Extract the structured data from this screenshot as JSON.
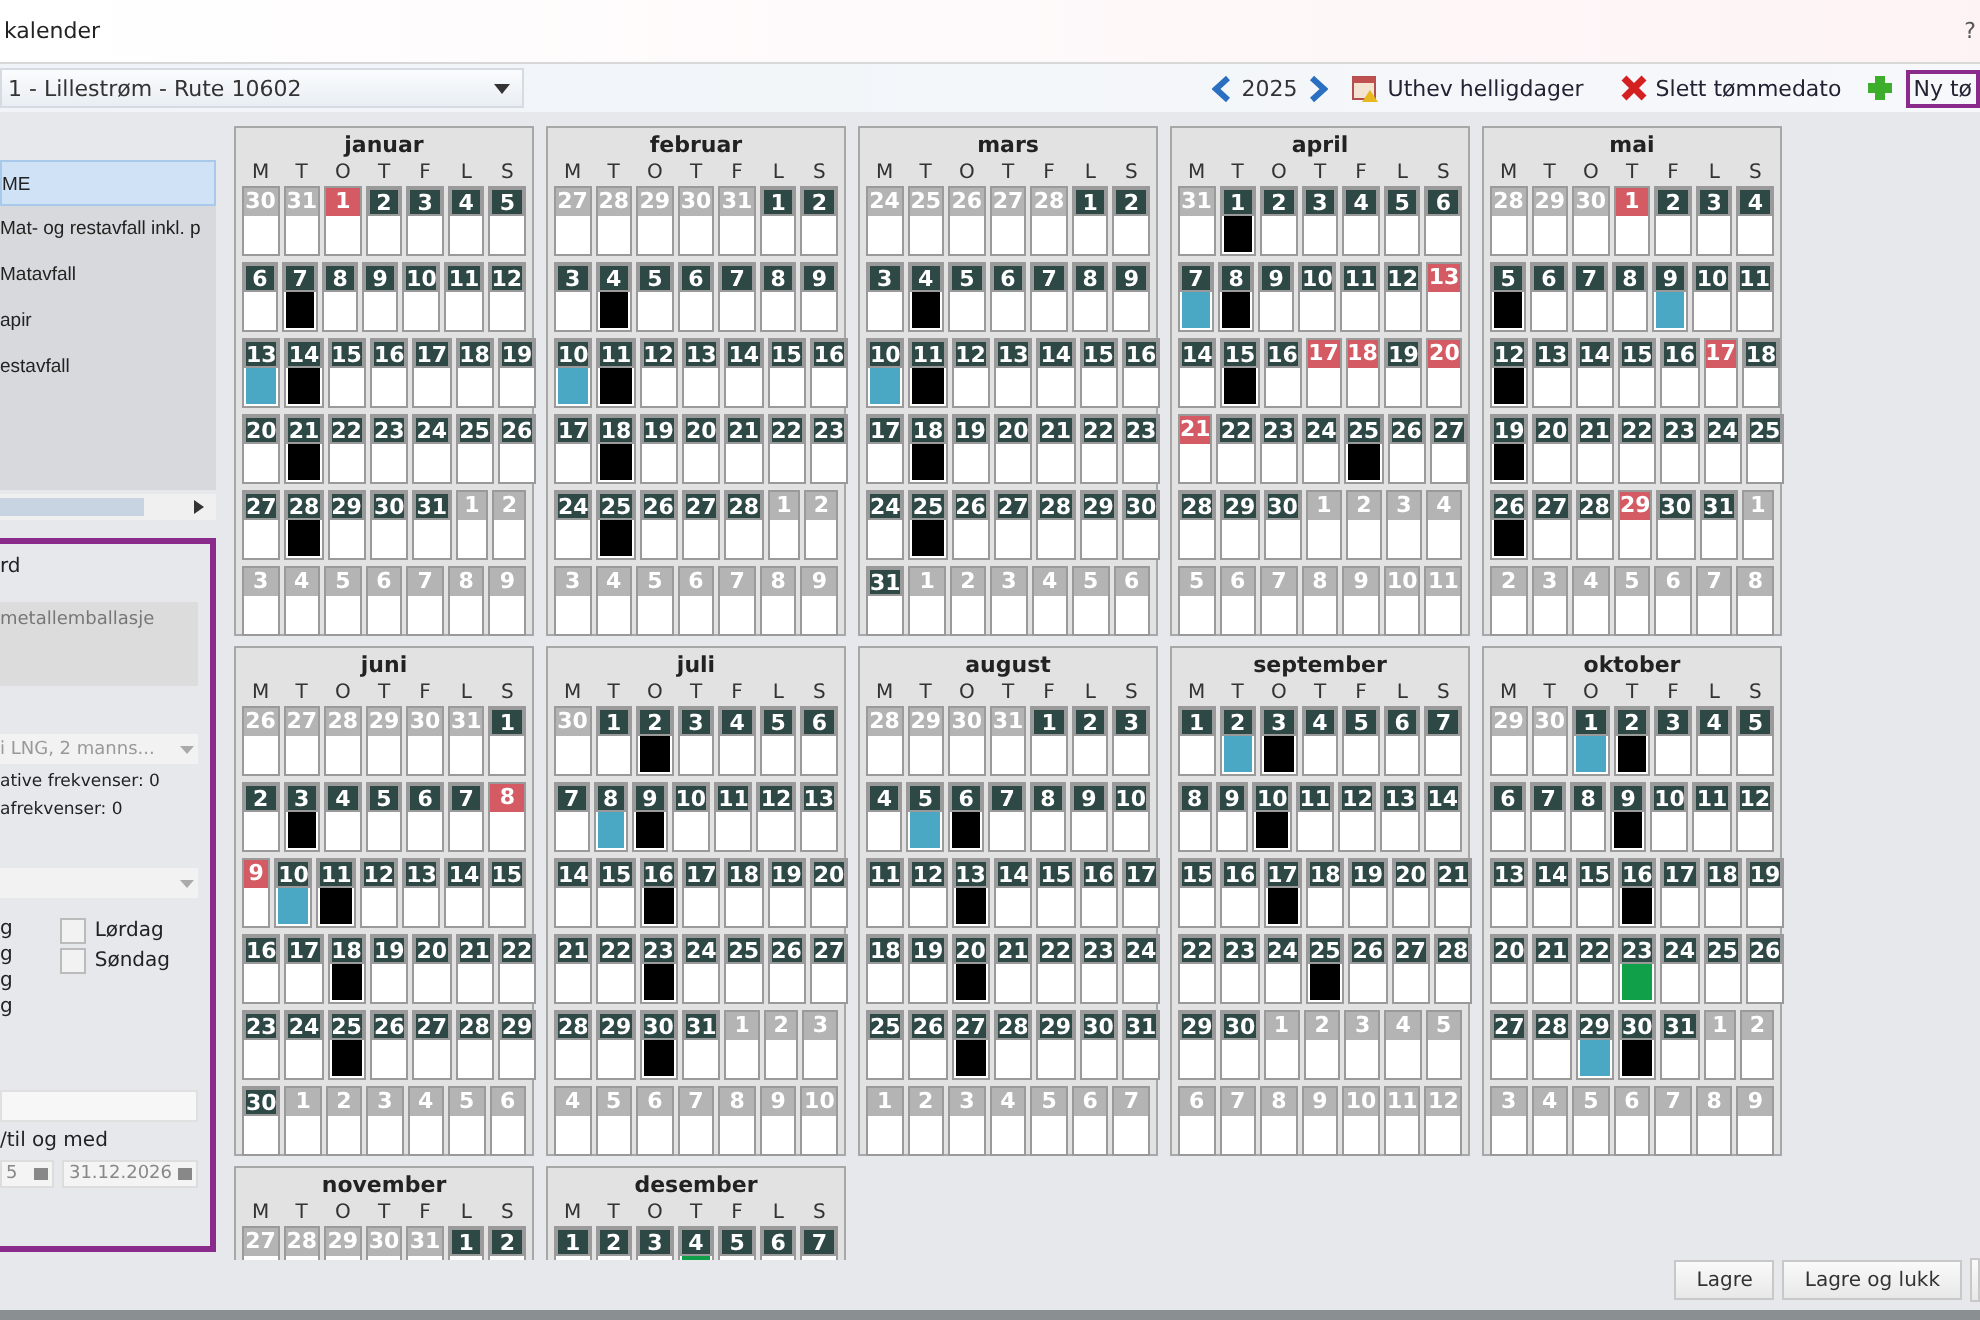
{
  "window": {
    "title": "kalender",
    "help": "?"
  },
  "route_select": {
    "value": "1 - Lillestrøm - Rute 10602"
  },
  "toolbar": {
    "year": "2025",
    "highlight_holidays": "Uthev helligdager",
    "delete_date": "Slett tømmedato",
    "new_date": "Ny tø"
  },
  "waste_list": {
    "items": [
      {
        "label": "ME",
        "selected": true
      },
      {
        "label": "Mat- og restavfall inkl. p",
        "selected": false
      },
      {
        "label": "Matavfall",
        "selected": false
      },
      {
        "label": "apir",
        "selected": false
      },
      {
        "label": "estavfall",
        "selected": false
      }
    ]
  },
  "details": {
    "label": "rd",
    "description": "metallemballasje",
    "vehicle_select": "i LNG, 2 manns...",
    "alt_freq": "ative frekvenser: 0",
    "extra_freq": "afrekvenser: 0",
    "weekdays": [
      "g",
      "g",
      "g",
      "g"
    ],
    "weekend": [
      {
        "label": "Lørdag",
        "checked": false
      },
      {
        "label": "Søndag",
        "checked": false
      }
    ],
    "period_label": "/til og med",
    "from_date": "5",
    "to_date": "31.12.2026"
  },
  "months": [
    {
      "name": "januar",
      "weekdays": [
        "M",
        "T",
        "O",
        "T",
        "F",
        "L",
        "S"
      ],
      "weeks": [
        [
          {
            "n": "30",
            "kind": "other"
          },
          {
            "n": "31",
            "kind": "other"
          },
          {
            "n": "1",
            "kind": "holiday"
          },
          {
            "n": "2",
            "kind": "day"
          },
          {
            "n": "3",
            "kind": "day"
          },
          {
            "n": "4",
            "kind": "day"
          },
          {
            "n": "5",
            "kind": "day"
          }
        ],
        [
          {
            "n": "6",
            "kind": "day"
          },
          {
            "n": "7",
            "kind": "day",
            "color": "#000000"
          },
          {
            "n": "8",
            "kind": "day"
          },
          {
            "n": "9",
            "kind": "day"
          },
          {
            "n": "10",
            "kind": "day"
          },
          {
            "n": "11",
            "kind": "day"
          },
          {
            "n": "12",
            "kind": "day"
          }
        ],
        [
          {
            "n": "13",
            "kind": "day",
            "color": "#4aa8c4"
          },
          {
            "n": "14",
            "kind": "day",
            "color": "#000000"
          },
          {
            "n": "15",
            "kind": "day"
          },
          {
            "n": "16",
            "kind": "day"
          },
          {
            "n": "17",
            "kind": "day"
          },
          {
            "n": "18",
            "kind": "day"
          },
          {
            "n": "19",
            "kind": "day"
          }
        ],
        [
          {
            "n": "20",
            "kind": "day"
          },
          {
            "n": "21",
            "kind": "day",
            "color": "#000000"
          },
          {
            "n": "22",
            "kind": "day"
          },
          {
            "n": "23",
            "kind": "day"
          },
          {
            "n": "24",
            "kind": "day"
          },
          {
            "n": "25",
            "kind": "day"
          },
          {
            "n": "26",
            "kind": "day"
          }
        ],
        [
          {
            "n": "27",
            "kind": "day"
          },
          {
            "n": "28",
            "kind": "day",
            "color": "#000000"
          },
          {
            "n": "29",
            "kind": "day"
          },
          {
            "n": "30",
            "kind": "day"
          },
          {
            "n": "31",
            "kind": "day"
          },
          {
            "n": "1",
            "kind": "other"
          },
          {
            "n": "2",
            "kind": "other"
          }
        ],
        [
          {
            "n": "3",
            "kind": "other"
          },
          {
            "n": "4",
            "kind": "other"
          },
          {
            "n": "5",
            "kind": "other"
          },
          {
            "n": "6",
            "kind": "other"
          },
          {
            "n": "7",
            "kind": "other"
          },
          {
            "n": "8",
            "kind": "other"
          },
          {
            "n": "9",
            "kind": "other"
          }
        ]
      ]
    },
    {
      "name": "februar",
      "weekdays": [
        "M",
        "T",
        "O",
        "T",
        "F",
        "L",
        "S"
      ],
      "weeks": [
        [
          {
            "n": "27",
            "kind": "other"
          },
          {
            "n": "28",
            "kind": "other"
          },
          {
            "n": "29",
            "kind": "other"
          },
          {
            "n": "30",
            "kind": "other"
          },
          {
            "n": "31",
            "kind": "other"
          },
          {
            "n": "1",
            "kind": "day"
          },
          {
            "n": "2",
            "kind": "day"
          }
        ],
        [
          {
            "n": "3",
            "kind": "day"
          },
          {
            "n": "4",
            "kind": "day",
            "color": "#000000"
          },
          {
            "n": "5",
            "kind": "day"
          },
          {
            "n": "6",
            "kind": "day"
          },
          {
            "n": "7",
            "kind": "day"
          },
          {
            "n": "8",
            "kind": "day"
          },
          {
            "n": "9",
            "kind": "day"
          }
        ],
        [
          {
            "n": "10",
            "kind": "day",
            "color": "#4aa8c4"
          },
          {
            "n": "11",
            "kind": "day",
            "color": "#000000"
          },
          {
            "n": "12",
            "kind": "day"
          },
          {
            "n": "13",
            "kind": "day"
          },
          {
            "n": "14",
            "kind": "day"
          },
          {
            "n": "15",
            "kind": "day"
          },
          {
            "n": "16",
            "kind": "day"
          }
        ],
        [
          {
            "n": "17",
            "kind": "day"
          },
          {
            "n": "18",
            "kind": "day",
            "color": "#000000"
          },
          {
            "n": "19",
            "kind": "day"
          },
          {
            "n": "20",
            "kind": "day"
          },
          {
            "n": "21",
            "kind": "day"
          },
          {
            "n": "22",
            "kind": "day"
          },
          {
            "n": "23",
            "kind": "day"
          }
        ],
        [
          {
            "n": "24",
            "kind": "day"
          },
          {
            "n": "25",
            "kind": "day",
            "color": "#000000"
          },
          {
            "n": "26",
            "kind": "day"
          },
          {
            "n": "27",
            "kind": "day"
          },
          {
            "n": "28",
            "kind": "day"
          },
          {
            "n": "1",
            "kind": "other"
          },
          {
            "n": "2",
            "kind": "other"
          }
        ],
        [
          {
            "n": "3",
            "kind": "other"
          },
          {
            "n": "4",
            "kind": "other"
          },
          {
            "n": "5",
            "kind": "other"
          },
          {
            "n": "6",
            "kind": "other"
          },
          {
            "n": "7",
            "kind": "other"
          },
          {
            "n": "8",
            "kind": "other"
          },
          {
            "n": "9",
            "kind": "other"
          }
        ]
      ]
    },
    {
      "name": "mars",
      "weekdays": [
        "M",
        "T",
        "O",
        "T",
        "F",
        "L",
        "S"
      ],
      "weeks": [
        [
          {
            "n": "24",
            "kind": "other"
          },
          {
            "n": "25",
            "kind": "other"
          },
          {
            "n": "26",
            "kind": "other"
          },
          {
            "n": "27",
            "kind": "other"
          },
          {
            "n": "28",
            "kind": "other"
          },
          {
            "n": "1",
            "kind": "day"
          },
          {
            "n": "2",
            "kind": "day"
          }
        ],
        [
          {
            "n": "3",
            "kind": "day"
          },
          {
            "n": "4",
            "kind": "day",
            "color": "#000000"
          },
          {
            "n": "5",
            "kind": "day"
          },
          {
            "n": "6",
            "kind": "day"
          },
          {
            "n": "7",
            "kind": "day"
          },
          {
            "n": "8",
            "kind": "day"
          },
          {
            "n": "9",
            "kind": "day"
          }
        ],
        [
          {
            "n": "10",
            "kind": "day",
            "color": "#4aa8c4"
          },
          {
            "n": "11",
            "kind": "day",
            "color": "#000000"
          },
          {
            "n": "12",
            "kind": "day"
          },
          {
            "n": "13",
            "kind": "day"
          },
          {
            "n": "14",
            "kind": "day"
          },
          {
            "n": "15",
            "kind": "day"
          },
          {
            "n": "16",
            "kind": "day"
          }
        ],
        [
          {
            "n": "17",
            "kind": "day"
          },
          {
            "n": "18",
            "kind": "day",
            "color": "#000000"
          },
          {
            "n": "19",
            "kind": "day"
          },
          {
            "n": "20",
            "kind": "day"
          },
          {
            "n": "21",
            "kind": "day"
          },
          {
            "n": "22",
            "kind": "day"
          },
          {
            "n": "23",
            "kind": "day"
          }
        ],
        [
          {
            "n": "24",
            "kind": "day"
          },
          {
            "n": "25",
            "kind": "day",
            "color": "#000000"
          },
          {
            "n": "26",
            "kind": "day"
          },
          {
            "n": "27",
            "kind": "day"
          },
          {
            "n": "28",
            "kind": "day"
          },
          {
            "n": "29",
            "kind": "day"
          },
          {
            "n": "30",
            "kind": "day"
          }
        ],
        [
          {
            "n": "31",
            "kind": "day"
          },
          {
            "n": "1",
            "kind": "other"
          },
          {
            "n": "2",
            "kind": "other"
          },
          {
            "n": "3",
            "kind": "other"
          },
          {
            "n": "4",
            "kind": "other"
          },
          {
            "n": "5",
            "kind": "other"
          },
          {
            "n": "6",
            "kind": "other"
          }
        ]
      ]
    },
    {
      "name": "april",
      "weekdays": [
        "M",
        "T",
        "O",
        "T",
        "F",
        "L",
        "S"
      ],
      "weeks": [
        [
          {
            "n": "31",
            "kind": "other"
          },
          {
            "n": "1",
            "kind": "day",
            "color": "#000000"
          },
          {
            "n": "2",
            "kind": "day"
          },
          {
            "n": "3",
            "kind": "day"
          },
          {
            "n": "4",
            "kind": "day"
          },
          {
            "n": "5",
            "kind": "day"
          },
          {
            "n": "6",
            "kind": "day"
          }
        ],
        [
          {
            "n": "7",
            "kind": "day",
            "color": "#4aa8c4"
          },
          {
            "n": "8",
            "kind": "day",
            "color": "#000000"
          },
          {
            "n": "9",
            "kind": "day"
          },
          {
            "n": "10",
            "kind": "day"
          },
          {
            "n": "11",
            "kind": "day"
          },
          {
            "n": "12",
            "kind": "day"
          },
          {
            "n": "13",
            "kind": "holiday"
          }
        ],
        [
          {
            "n": "14",
            "kind": "day"
          },
          {
            "n": "15",
            "kind": "day",
            "color": "#000000"
          },
          {
            "n": "16",
            "kind": "day"
          },
          {
            "n": "17",
            "kind": "holiday"
          },
          {
            "n": "18",
            "kind": "holiday"
          },
          {
            "n": "19",
            "kind": "day"
          },
          {
            "n": "20",
            "kind": "holiday"
          }
        ],
        [
          {
            "n": "21",
            "kind": "holiday"
          },
          {
            "n": "22",
            "kind": "day"
          },
          {
            "n": "23",
            "kind": "day"
          },
          {
            "n": "24",
            "kind": "day"
          },
          {
            "n": "25",
            "kind": "day",
            "color": "#000000"
          },
          {
            "n": "26",
            "kind": "day"
          },
          {
            "n": "27",
            "kind": "day"
          }
        ],
        [
          {
            "n": "28",
            "kind": "day"
          },
          {
            "n": "29",
            "kind": "day"
          },
          {
            "n": "30",
            "kind": "day"
          },
          {
            "n": "1",
            "kind": "other"
          },
          {
            "n": "2",
            "kind": "other"
          },
          {
            "n": "3",
            "kind": "other"
          },
          {
            "n": "4",
            "kind": "other"
          }
        ],
        [
          {
            "n": "5",
            "kind": "other"
          },
          {
            "n": "6",
            "kind": "other"
          },
          {
            "n": "7",
            "kind": "other"
          },
          {
            "n": "8",
            "kind": "other"
          },
          {
            "n": "9",
            "kind": "other"
          },
          {
            "n": "10",
            "kind": "other"
          },
          {
            "n": "11",
            "kind": "other"
          }
        ]
      ]
    },
    {
      "name": "mai",
      "weekdays": [
        "M",
        "T",
        "O",
        "T",
        "F",
        "L",
        "S"
      ],
      "weeks": [
        [
          {
            "n": "28",
            "kind": "other"
          },
          {
            "n": "29",
            "kind": "other"
          },
          {
            "n": "30",
            "kind": "other"
          },
          {
            "n": "1",
            "kind": "holiday"
          },
          {
            "n": "2",
            "kind": "day"
          },
          {
            "n": "3",
            "kind": "day"
          },
          {
            "n": "4",
            "kind": "day"
          }
        ],
        [
          {
            "n": "5",
            "kind": "day",
            "color": "#000000"
          },
          {
            "n": "6",
            "kind": "day"
          },
          {
            "n": "7",
            "kind": "day"
          },
          {
            "n": "8",
            "kind": "day"
          },
          {
            "n": "9",
            "kind": "day",
            "color": "#4aa8c4"
          },
          {
            "n": "10",
            "kind": "day"
          },
          {
            "n": "11",
            "kind": "day"
          }
        ],
        [
          {
            "n": "12",
            "kind": "day",
            "color": "#000000"
          },
          {
            "n": "13",
            "kind": "day"
          },
          {
            "n": "14",
            "kind": "day"
          },
          {
            "n": "15",
            "kind": "day"
          },
          {
            "n": "16",
            "kind": "day"
          },
          {
            "n": "17",
            "kind": "holiday"
          },
          {
            "n": "18",
            "kind": "day"
          }
        ],
        [
          {
            "n": "19",
            "kind": "day",
            "color": "#000000"
          },
          {
            "n": "20",
            "kind": "day"
          },
          {
            "n": "21",
            "kind": "day"
          },
          {
            "n": "22",
            "kind": "day"
          },
          {
            "n": "23",
            "kind": "day"
          },
          {
            "n": "24",
            "kind": "day"
          },
          {
            "n": "25",
            "kind": "day"
          }
        ],
        [
          {
            "n": "26",
            "kind": "day",
            "color": "#000000"
          },
          {
            "n": "27",
            "kind": "day"
          },
          {
            "n": "28",
            "kind": "day"
          },
          {
            "n": "29",
            "kind": "holiday"
          },
          {
            "n": "30",
            "kind": "day"
          },
          {
            "n": "31",
            "kind": "day"
          },
          {
            "n": "1",
            "kind": "other"
          }
        ],
        [
          {
            "n": "2",
            "kind": "other"
          },
          {
            "n": "3",
            "kind": "other"
          },
          {
            "n": "4",
            "kind": "other"
          },
          {
            "n": "5",
            "kind": "other"
          },
          {
            "n": "6",
            "kind": "other"
          },
          {
            "n": "7",
            "kind": "other"
          },
          {
            "n": "8",
            "kind": "other"
          }
        ]
      ]
    },
    {
      "name": "juni",
      "weekdays": [
        "M",
        "T",
        "O",
        "T",
        "F",
        "L",
        "S"
      ],
      "weeks": [
        [
          {
            "n": "26",
            "kind": "other"
          },
          {
            "n": "27",
            "kind": "other"
          },
          {
            "n": "28",
            "kind": "other"
          },
          {
            "n": "29",
            "kind": "other"
          },
          {
            "n": "30",
            "kind": "other"
          },
          {
            "n": "31",
            "kind": "other"
          },
          {
            "n": "1",
            "kind": "day"
          }
        ],
        [
          {
            "n": "2",
            "kind": "day"
          },
          {
            "n": "3",
            "kind": "day",
            "color": "#000000"
          },
          {
            "n": "4",
            "kind": "day"
          },
          {
            "n": "5",
            "kind": "day"
          },
          {
            "n": "6",
            "kind": "day"
          },
          {
            "n": "7",
            "kind": "day"
          },
          {
            "n": "8",
            "kind": "holiday"
          }
        ],
        [
          {
            "n": "9",
            "kind": "holiday"
          },
          {
            "n": "10",
            "kind": "day",
            "color": "#4aa8c4"
          },
          {
            "n": "11",
            "kind": "day",
            "color": "#000000"
          },
          {
            "n": "12",
            "kind": "day"
          },
          {
            "n": "13",
            "kind": "day"
          },
          {
            "n": "14",
            "kind": "day"
          },
          {
            "n": "15",
            "kind": "day"
          }
        ],
        [
          {
            "n": "16",
            "kind": "day"
          },
          {
            "n": "17",
            "kind": "day"
          },
          {
            "n": "18",
            "kind": "day",
            "color": "#000000"
          },
          {
            "n": "19",
            "kind": "day"
          },
          {
            "n": "20",
            "kind": "day"
          },
          {
            "n": "21",
            "kind": "day"
          },
          {
            "n": "22",
            "kind": "day"
          }
        ],
        [
          {
            "n": "23",
            "kind": "day"
          },
          {
            "n": "24",
            "kind": "day"
          },
          {
            "n": "25",
            "kind": "day",
            "color": "#000000"
          },
          {
            "n": "26",
            "kind": "day"
          },
          {
            "n": "27",
            "kind": "day"
          },
          {
            "n": "28",
            "kind": "day"
          },
          {
            "n": "29",
            "kind": "day"
          }
        ],
        [
          {
            "n": "30",
            "kind": "day"
          },
          {
            "n": "1",
            "kind": "other"
          },
          {
            "n": "2",
            "kind": "other"
          },
          {
            "n": "3",
            "kind": "other"
          },
          {
            "n": "4",
            "kind": "other"
          },
          {
            "n": "5",
            "kind": "other"
          },
          {
            "n": "6",
            "kind": "other"
          }
        ]
      ]
    },
    {
      "name": "juli",
      "weekdays": [
        "M",
        "T",
        "O",
        "T",
        "F",
        "L",
        "S"
      ],
      "weeks": [
        [
          {
            "n": "30",
            "kind": "other"
          },
          {
            "n": "1",
            "kind": "day"
          },
          {
            "n": "2",
            "kind": "day",
            "color": "#000000"
          },
          {
            "n": "3",
            "kind": "day"
          },
          {
            "n": "4",
            "kind": "day"
          },
          {
            "n": "5",
            "kind": "day"
          },
          {
            "n": "6",
            "kind": "day"
          }
        ],
        [
          {
            "n": "7",
            "kind": "day"
          },
          {
            "n": "8",
            "kind": "day",
            "color": "#4aa8c4"
          },
          {
            "n": "9",
            "kind": "day",
            "color": "#000000"
          },
          {
            "n": "10",
            "kind": "day"
          },
          {
            "n": "11",
            "kind": "day"
          },
          {
            "n": "12",
            "kind": "day"
          },
          {
            "n": "13",
            "kind": "day"
          }
        ],
        [
          {
            "n": "14",
            "kind": "day"
          },
          {
            "n": "15",
            "kind": "day"
          },
          {
            "n": "16",
            "kind": "day",
            "color": "#000000"
          },
          {
            "n": "17",
            "kind": "day"
          },
          {
            "n": "18",
            "kind": "day"
          },
          {
            "n": "19",
            "kind": "day"
          },
          {
            "n": "20",
            "kind": "day"
          }
        ],
        [
          {
            "n": "21",
            "kind": "day"
          },
          {
            "n": "22",
            "kind": "day"
          },
          {
            "n": "23",
            "kind": "day",
            "color": "#000000"
          },
          {
            "n": "24",
            "kind": "day"
          },
          {
            "n": "25",
            "kind": "day"
          },
          {
            "n": "26",
            "kind": "day"
          },
          {
            "n": "27",
            "kind": "day"
          }
        ],
        [
          {
            "n": "28",
            "kind": "day"
          },
          {
            "n": "29",
            "kind": "day"
          },
          {
            "n": "30",
            "kind": "day",
            "color": "#000000"
          },
          {
            "n": "31",
            "kind": "day"
          },
          {
            "n": "1",
            "kind": "other"
          },
          {
            "n": "2",
            "kind": "other"
          },
          {
            "n": "3",
            "kind": "other"
          }
        ],
        [
          {
            "n": "4",
            "kind": "other"
          },
          {
            "n": "5",
            "kind": "other"
          },
          {
            "n": "6",
            "kind": "other"
          },
          {
            "n": "7",
            "kind": "other"
          },
          {
            "n": "8",
            "kind": "other"
          },
          {
            "n": "9",
            "kind": "other"
          },
          {
            "n": "10",
            "kind": "other"
          }
        ]
      ]
    },
    {
      "name": "august",
      "weekdays": [
        "M",
        "T",
        "O",
        "T",
        "F",
        "L",
        "S"
      ],
      "weeks": [
        [
          {
            "n": "28",
            "kind": "other"
          },
          {
            "n": "29",
            "kind": "other"
          },
          {
            "n": "30",
            "kind": "other"
          },
          {
            "n": "31",
            "kind": "other"
          },
          {
            "n": "1",
            "kind": "day"
          },
          {
            "n": "2",
            "kind": "day"
          },
          {
            "n": "3",
            "kind": "day"
          }
        ],
        [
          {
            "n": "4",
            "kind": "day"
          },
          {
            "n": "5",
            "kind": "day",
            "color": "#4aa8c4"
          },
          {
            "n": "6",
            "kind": "day",
            "color": "#000000"
          },
          {
            "n": "7",
            "kind": "day"
          },
          {
            "n": "8",
            "kind": "day"
          },
          {
            "n": "9",
            "kind": "day"
          },
          {
            "n": "10",
            "kind": "day"
          }
        ],
        [
          {
            "n": "11",
            "kind": "day"
          },
          {
            "n": "12",
            "kind": "day"
          },
          {
            "n": "13",
            "kind": "day",
            "color": "#000000"
          },
          {
            "n": "14",
            "kind": "day"
          },
          {
            "n": "15",
            "kind": "day"
          },
          {
            "n": "16",
            "kind": "day"
          },
          {
            "n": "17",
            "kind": "day"
          }
        ],
        [
          {
            "n": "18",
            "kind": "day"
          },
          {
            "n": "19",
            "kind": "day"
          },
          {
            "n": "20",
            "kind": "day",
            "color": "#000000"
          },
          {
            "n": "21",
            "kind": "day"
          },
          {
            "n": "22",
            "kind": "day"
          },
          {
            "n": "23",
            "kind": "day"
          },
          {
            "n": "24",
            "kind": "day"
          }
        ],
        [
          {
            "n": "25",
            "kind": "day"
          },
          {
            "n": "26",
            "kind": "day"
          },
          {
            "n": "27",
            "kind": "day",
            "color": "#000000"
          },
          {
            "n": "28",
            "kind": "day"
          },
          {
            "n": "29",
            "kind": "day"
          },
          {
            "n": "30",
            "kind": "day"
          },
          {
            "n": "31",
            "kind": "day"
          }
        ],
        [
          {
            "n": "1",
            "kind": "other"
          },
          {
            "n": "2",
            "kind": "other"
          },
          {
            "n": "3",
            "kind": "other"
          },
          {
            "n": "4",
            "kind": "other"
          },
          {
            "n": "5",
            "kind": "other"
          },
          {
            "n": "6",
            "kind": "other"
          },
          {
            "n": "7",
            "kind": "other"
          }
        ]
      ]
    },
    {
      "name": "september",
      "weekdays": [
        "M",
        "T",
        "O",
        "T",
        "F",
        "L",
        "S"
      ],
      "weeks": [
        [
          {
            "n": "1",
            "kind": "day"
          },
          {
            "n": "2",
            "kind": "day",
            "color": "#4aa8c4"
          },
          {
            "n": "3",
            "kind": "day",
            "color": "#000000"
          },
          {
            "n": "4",
            "kind": "day"
          },
          {
            "n": "5",
            "kind": "day"
          },
          {
            "n": "6",
            "kind": "day"
          },
          {
            "n": "7",
            "kind": "day"
          }
        ],
        [
          {
            "n": "8",
            "kind": "day"
          },
          {
            "n": "9",
            "kind": "day"
          },
          {
            "n": "10",
            "kind": "day",
            "color": "#000000"
          },
          {
            "n": "11",
            "kind": "day"
          },
          {
            "n": "12",
            "kind": "day"
          },
          {
            "n": "13",
            "kind": "day"
          },
          {
            "n": "14",
            "kind": "day"
          }
        ],
        [
          {
            "n": "15",
            "kind": "day"
          },
          {
            "n": "16",
            "kind": "day"
          },
          {
            "n": "17",
            "kind": "day",
            "color": "#000000"
          },
          {
            "n": "18",
            "kind": "day"
          },
          {
            "n": "19",
            "kind": "day"
          },
          {
            "n": "20",
            "kind": "day"
          },
          {
            "n": "21",
            "kind": "day"
          }
        ],
        [
          {
            "n": "22",
            "kind": "day"
          },
          {
            "n": "23",
            "kind": "day"
          },
          {
            "n": "24",
            "kind": "day"
          },
          {
            "n": "25",
            "kind": "day",
            "color": "#000000"
          },
          {
            "n": "26",
            "kind": "day"
          },
          {
            "n": "27",
            "kind": "day"
          },
          {
            "n": "28",
            "kind": "day"
          }
        ],
        [
          {
            "n": "29",
            "kind": "day"
          },
          {
            "n": "30",
            "kind": "day"
          },
          {
            "n": "1",
            "kind": "other"
          },
          {
            "n": "2",
            "kind": "other"
          },
          {
            "n": "3",
            "kind": "other"
          },
          {
            "n": "4",
            "kind": "other"
          },
          {
            "n": "5",
            "kind": "other"
          }
        ],
        [
          {
            "n": "6",
            "kind": "other"
          },
          {
            "n": "7",
            "kind": "other"
          },
          {
            "n": "8",
            "kind": "other"
          },
          {
            "n": "9",
            "kind": "other"
          },
          {
            "n": "10",
            "kind": "other"
          },
          {
            "n": "11",
            "kind": "other"
          },
          {
            "n": "12",
            "kind": "other"
          }
        ]
      ]
    },
    {
      "name": "oktober",
      "weekdays": [
        "M",
        "T",
        "O",
        "T",
        "F",
        "L",
        "S"
      ],
      "weeks": [
        [
          {
            "n": "29",
            "kind": "other"
          },
          {
            "n": "30",
            "kind": "other"
          },
          {
            "n": "1",
            "kind": "day",
            "color": "#4aa8c4"
          },
          {
            "n": "2",
            "kind": "day",
            "color": "#000000"
          },
          {
            "n": "3",
            "kind": "day"
          },
          {
            "n": "4",
            "kind": "day"
          },
          {
            "n": "5",
            "kind": "day"
          }
        ],
        [
          {
            "n": "6",
            "kind": "day"
          },
          {
            "n": "7",
            "kind": "day"
          },
          {
            "n": "8",
            "kind": "day"
          },
          {
            "n": "9",
            "kind": "day",
            "color": "#000000"
          },
          {
            "n": "10",
            "kind": "day"
          },
          {
            "n": "11",
            "kind": "day"
          },
          {
            "n": "12",
            "kind": "day"
          }
        ],
        [
          {
            "n": "13",
            "kind": "day"
          },
          {
            "n": "14",
            "kind": "day"
          },
          {
            "n": "15",
            "kind": "day"
          },
          {
            "n": "16",
            "kind": "day",
            "color": "#000000"
          },
          {
            "n": "17",
            "kind": "day"
          },
          {
            "n": "18",
            "kind": "day"
          },
          {
            "n": "19",
            "kind": "day"
          }
        ],
        [
          {
            "n": "20",
            "kind": "day"
          },
          {
            "n": "21",
            "kind": "day"
          },
          {
            "n": "22",
            "kind": "day"
          },
          {
            "n": "23",
            "kind": "day",
            "color": "#10a04a"
          },
          {
            "n": "24",
            "kind": "day"
          },
          {
            "n": "25",
            "kind": "day"
          },
          {
            "n": "26",
            "kind": "day"
          }
        ],
        [
          {
            "n": "27",
            "kind": "day"
          },
          {
            "n": "28",
            "kind": "day"
          },
          {
            "n": "29",
            "kind": "day",
            "color": "#4aa8c4"
          },
          {
            "n": "30",
            "kind": "day",
            "color": "#000000"
          },
          {
            "n": "31",
            "kind": "day"
          },
          {
            "n": "1",
            "kind": "other"
          },
          {
            "n": "2",
            "kind": "other"
          }
        ],
        [
          {
            "n": "3",
            "kind": "other"
          },
          {
            "n": "4",
            "kind": "other"
          },
          {
            "n": "5",
            "kind": "other"
          },
          {
            "n": "6",
            "kind": "other"
          },
          {
            "n": "7",
            "kind": "other"
          },
          {
            "n": "8",
            "kind": "other"
          },
          {
            "n": "9",
            "kind": "other"
          }
        ]
      ]
    },
    {
      "name": "november",
      "weekdays": [
        "M",
        "T",
        "O",
        "T",
        "F",
        "L",
        "S"
      ],
      "weeks": [
        [
          {
            "n": "27",
            "kind": "other"
          },
          {
            "n": "28",
            "kind": "other"
          },
          {
            "n": "29",
            "kind": "other"
          },
          {
            "n": "30",
            "kind": "other"
          },
          {
            "n": "31",
            "kind": "other"
          },
          {
            "n": "1",
            "kind": "day"
          },
          {
            "n": "2",
            "kind": "day"
          }
        ]
      ]
    },
    {
      "name": "desember",
      "weekdays": [
        "M",
        "T",
        "O",
        "T",
        "F",
        "L",
        "S"
      ],
      "weeks": [
        [
          {
            "n": "1",
            "kind": "day"
          },
          {
            "n": "2",
            "kind": "day"
          },
          {
            "n": "3",
            "kind": "day"
          },
          {
            "n": "4",
            "kind": "day",
            "color": "#10a04a"
          },
          {
            "n": "5",
            "kind": "day"
          },
          {
            "n": "6",
            "kind": "day"
          },
          {
            "n": "7",
            "kind": "day"
          }
        ]
      ]
    }
  ],
  "buttons": [
    "Lagre",
    "Lagre og lukk"
  ]
}
